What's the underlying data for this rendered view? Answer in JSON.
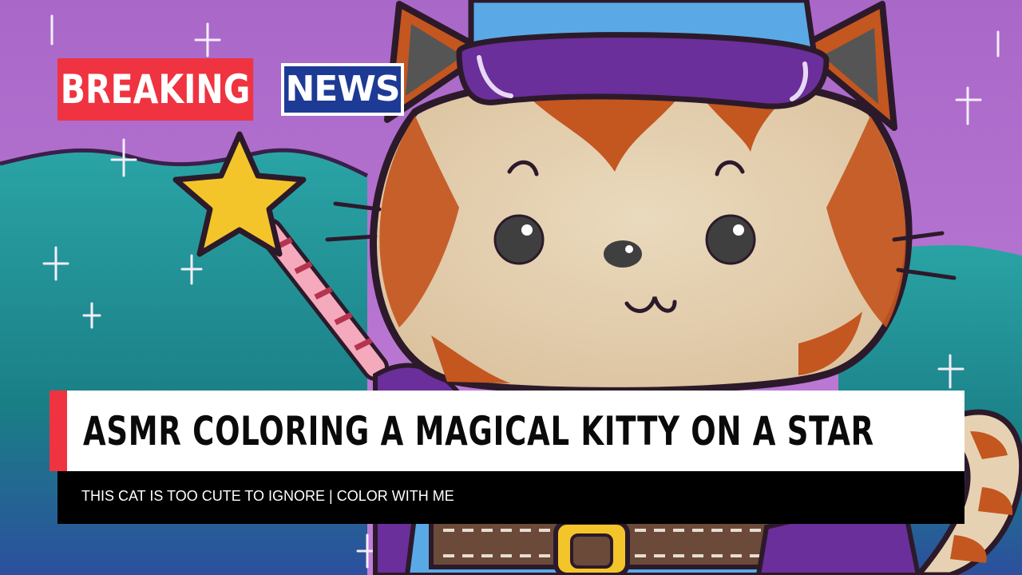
{
  "badge": {
    "primary": "BREAKING",
    "secondary": "NEWS"
  },
  "lower_third": {
    "headline": "ASMR COLORING A MAGICAL KITTY ON A STAR",
    "subline": "THIS CAT IS TOO CUTE TO IGNORE | COLOR WITH ME"
  },
  "colors": {
    "badge_red": "#ef3340",
    "badge_blue": "#1d3a94",
    "sky_purple": "#b06fcf",
    "hills_teal": "#1f8f8f",
    "cat_orange": "#c4561f",
    "cat_cream": "#e6d2b2",
    "hat_blue": "#5aa9e6",
    "hat_band_purple": "#6a2f9a",
    "star_yellow": "#f4c52a"
  },
  "illustration": {
    "subject": "cartoon-cat-with-wizard-hat-and-star-wand"
  }
}
